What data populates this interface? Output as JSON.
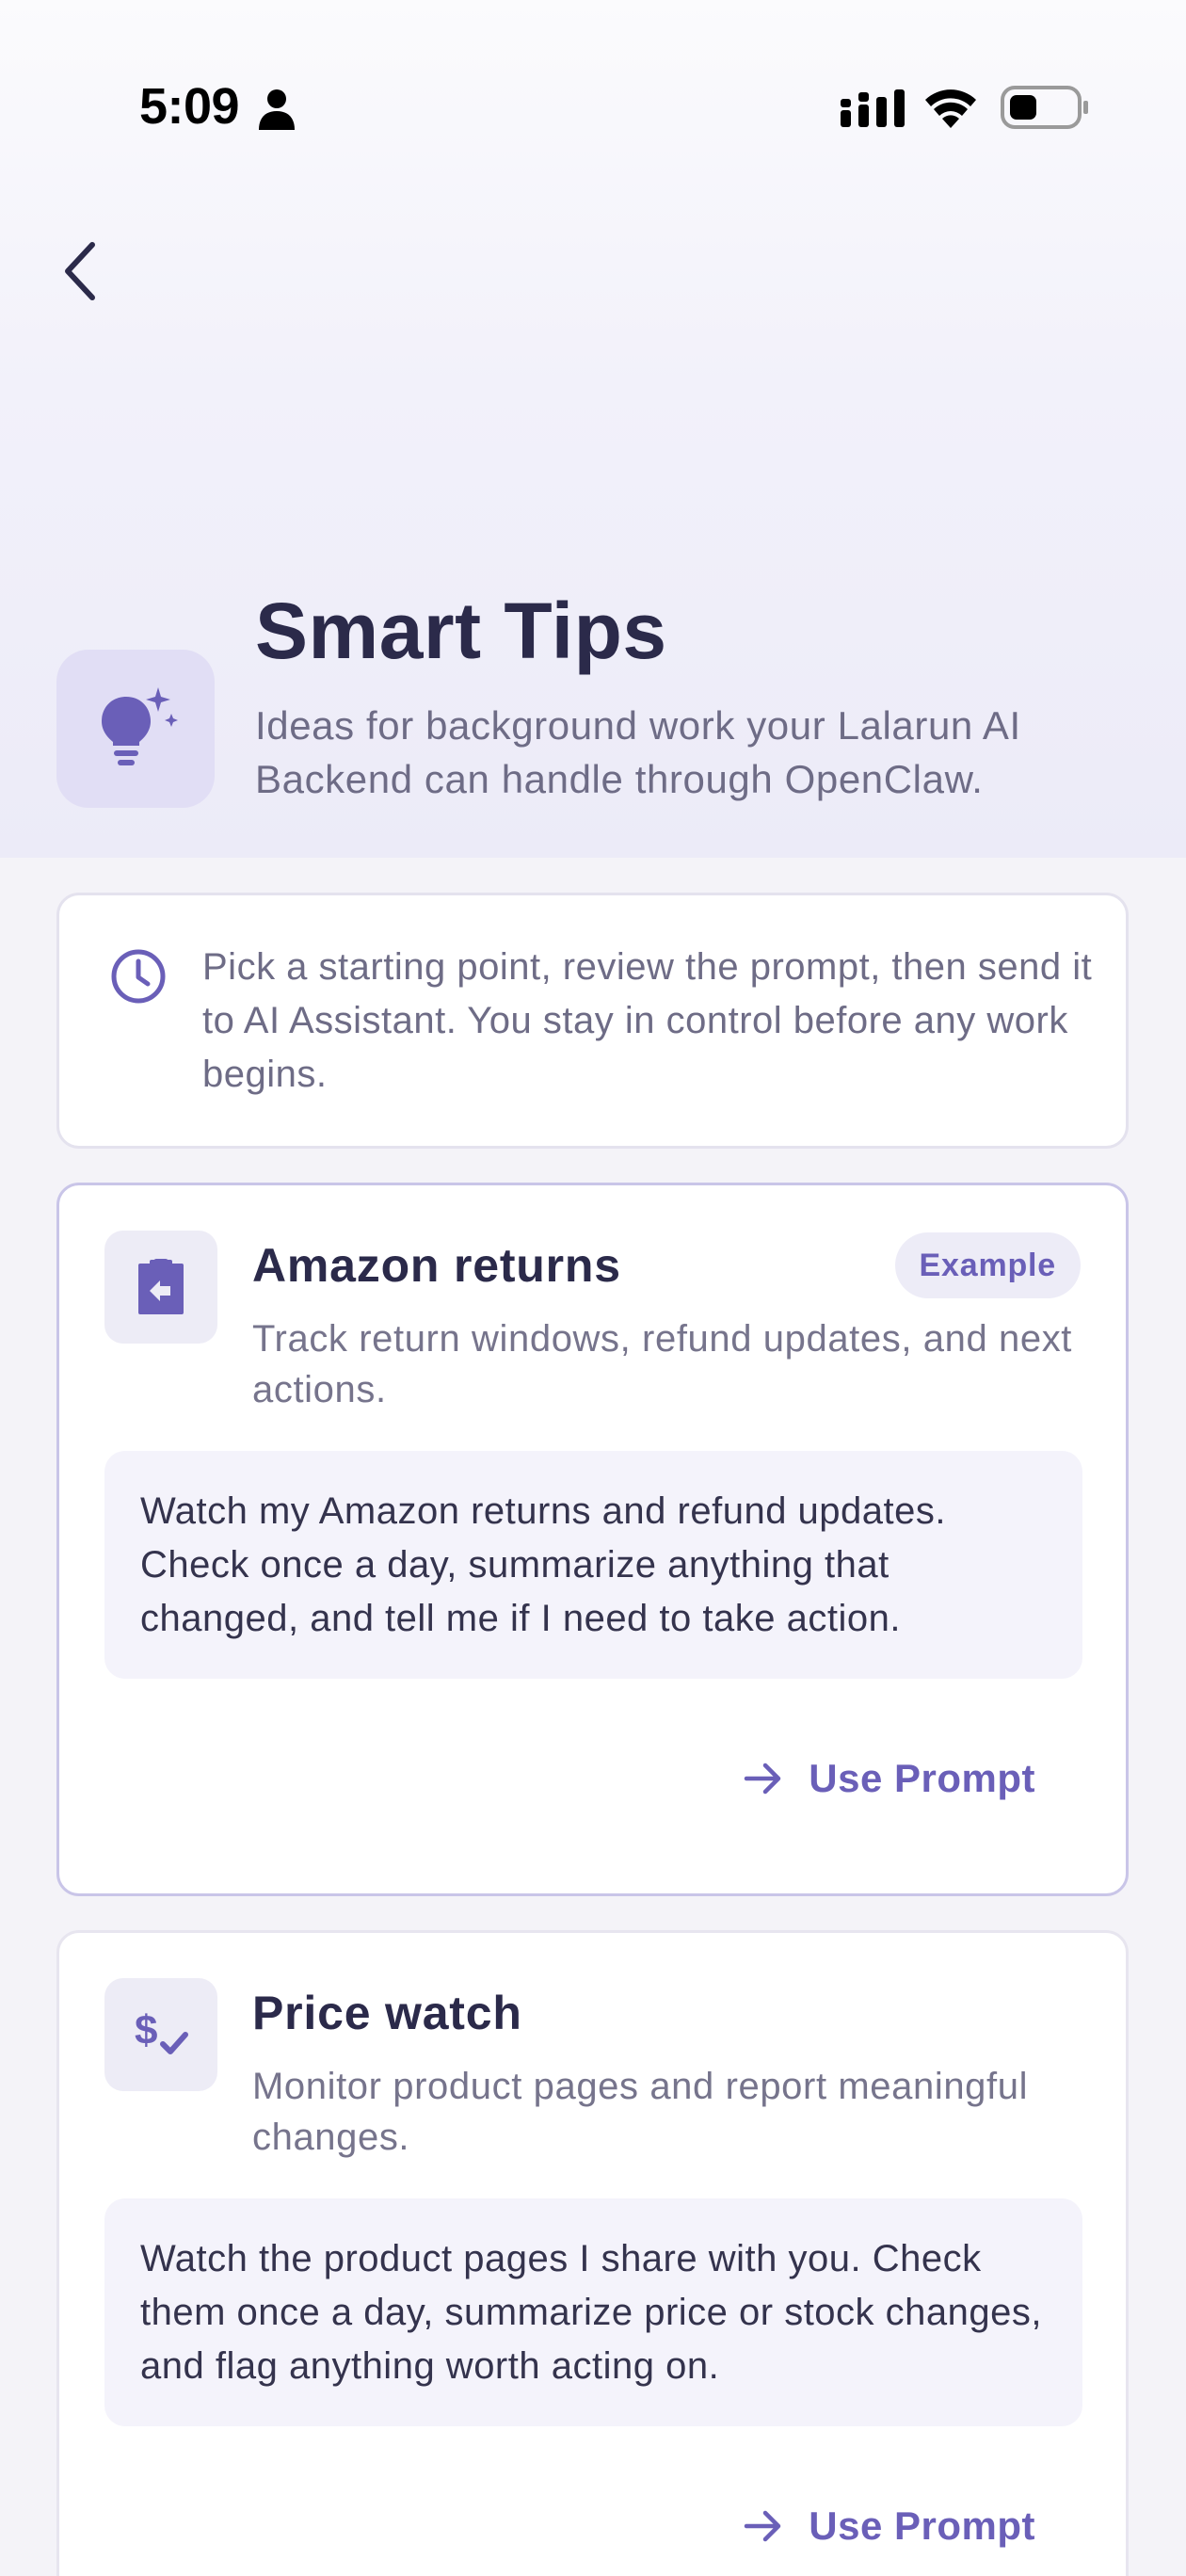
{
  "status_bar": {
    "time": "5:09"
  },
  "header": {
    "title": "Smart Tips",
    "subtitle": "Ideas for background work your Lalarun AI Backend can handle through OpenClaw.",
    "icon": "lightbulb-sparkle-icon"
  },
  "info": {
    "icon": "clock-icon",
    "text": "Pick a starting point, review the prompt, then send it to AI Assistant. You stay in control before any work begins."
  },
  "tips": [
    {
      "icon": "clipboard-return-icon",
      "title": "Amazon returns",
      "badge": "Example",
      "description": "Track return windows, refund updates, and next actions.",
      "prompt": "Watch my Amazon returns and refund updates. Check once a day, summarize anything that changed, and tell me if I need to take action.",
      "action_label": "Use Prompt"
    },
    {
      "icon": "price-check-icon",
      "title": "Price watch",
      "description": "Monitor product pages and report meaningful changes.",
      "prompt": "Watch the product pages I share with you. Check them once a day, summarize price or stock changes, and flag anything worth acting on.",
      "action_label": "Use Prompt"
    }
  ],
  "colors": {
    "accent": "#6a5fb8",
    "title": "#2b2a4a",
    "muted": "#6e6c86",
    "background": "#f4f3f8"
  }
}
